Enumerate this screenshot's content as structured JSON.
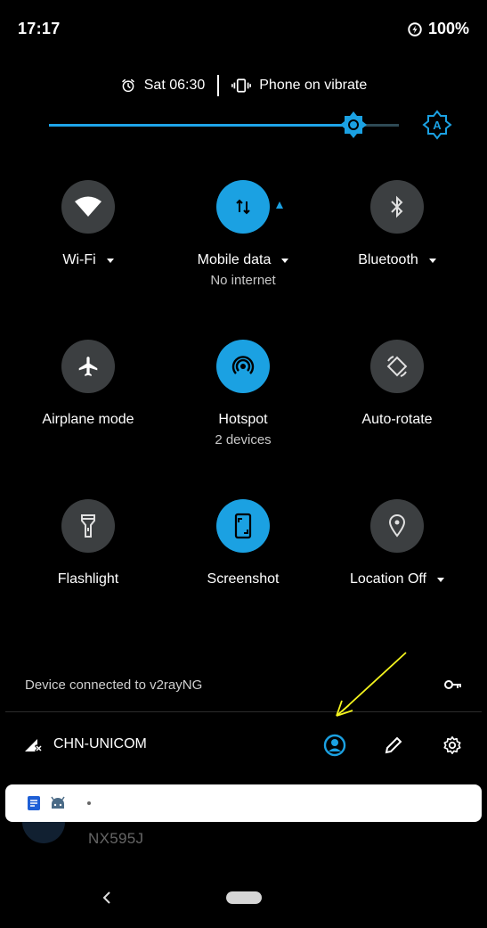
{
  "status_bar": {
    "time": "17:17",
    "battery": "100%"
  },
  "info_row": {
    "alarm": "Sat 06:30",
    "ringer": "Phone on vibrate"
  },
  "brightness": {
    "level": 0.87
  },
  "tiles": [
    {
      "label": "Wi-Fi",
      "sub": "",
      "active": false,
      "icon": "wifi-icon",
      "has_dropdown": true
    },
    {
      "label": "Mobile data",
      "sub": "No internet",
      "active": true,
      "icon": "mobile-data-icon",
      "has_dropdown": true
    },
    {
      "label": "Bluetooth",
      "sub": "",
      "active": false,
      "icon": "bluetooth-icon",
      "has_dropdown": true
    },
    {
      "label": "Airplane mode",
      "sub": "",
      "active": false,
      "icon": "airplane-icon",
      "has_dropdown": false
    },
    {
      "label": "Hotspot",
      "sub": "2 devices",
      "active": true,
      "icon": "hotspot-icon",
      "has_dropdown": false
    },
    {
      "label": "Auto-rotate",
      "sub": "",
      "active": false,
      "icon": "auto-rotate-icon",
      "has_dropdown": false
    },
    {
      "label": "Flashlight",
      "sub": "",
      "active": false,
      "icon": "flashlight-icon",
      "has_dropdown": false
    },
    {
      "label": "Screenshot",
      "sub": "",
      "active": true,
      "icon": "screenshot-icon",
      "has_dropdown": false
    },
    {
      "label": "Location Off",
      "sub": "",
      "active": false,
      "icon": "location-icon",
      "has_dropdown": true
    }
  ],
  "vpn": {
    "text": "Device connected to v2rayNG"
  },
  "footer": {
    "carrier": "CHN-UNICOM"
  },
  "notification_behind": {
    "text": "NX595J"
  },
  "colors": {
    "accent": "#1ba1e2",
    "tile_off": "#3c3f41",
    "annotation_arrow": "#f5f51e"
  }
}
